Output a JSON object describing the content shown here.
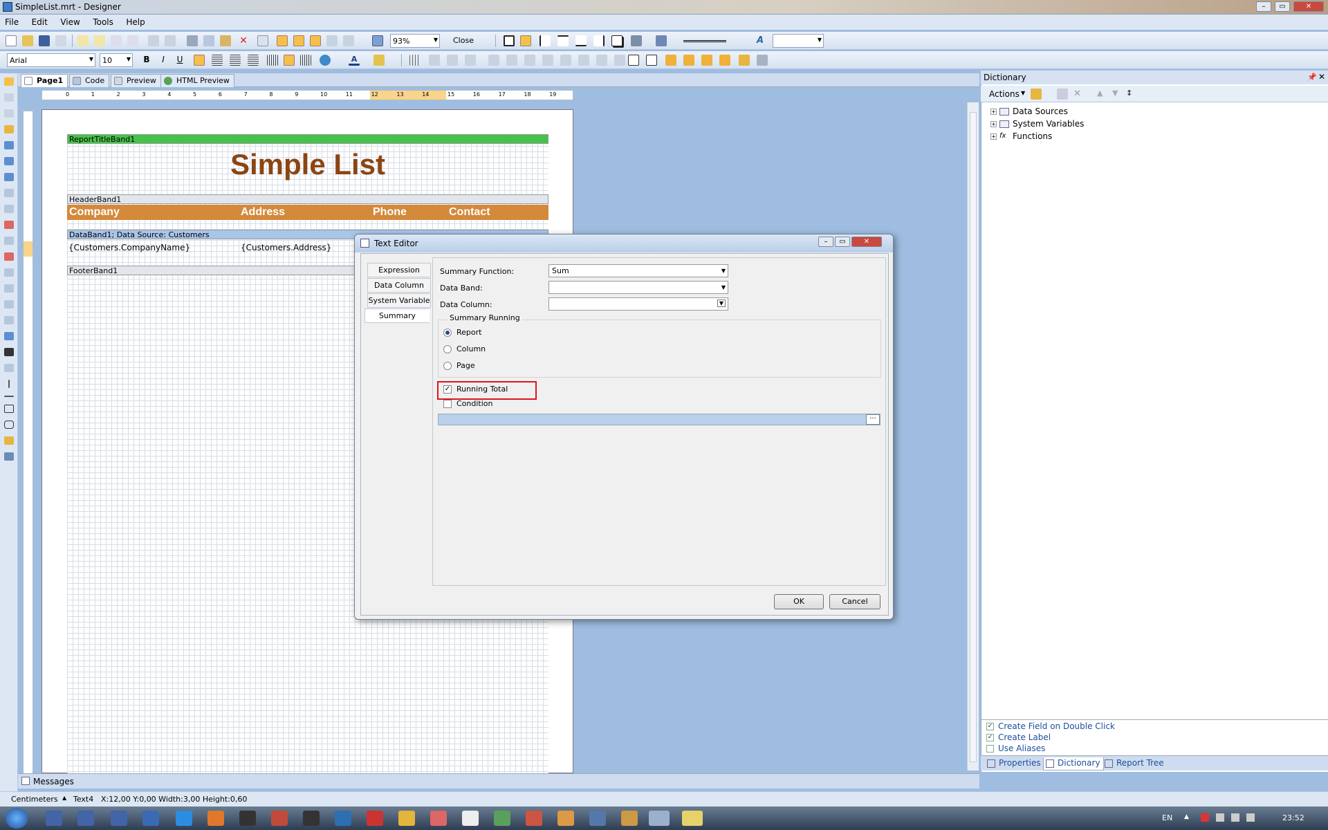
{
  "window": {
    "title": "SimpleList.mrt - Designer"
  },
  "menu": [
    "File",
    "Edit",
    "View",
    "Tools",
    "Help"
  ],
  "toolbar": {
    "zoom": "93%",
    "close_label": "Close"
  },
  "format": {
    "font": "Arial",
    "size": "10",
    "bold": "B",
    "italic": "I",
    "underline": "U"
  },
  "doc_tabs": [
    "Page1",
    "Code",
    "Preview",
    "HTML Preview"
  ],
  "ruler_marks": [
    "0",
    "1",
    "2",
    "3",
    "4",
    "5",
    "6",
    "7",
    "8",
    "9",
    "10",
    "11",
    "12",
    "13",
    "14",
    "15",
    "16",
    "17",
    "18",
    "19"
  ],
  "report": {
    "title_band": "ReportTitleBand1",
    "title_text": "Simple List",
    "header_band": "HeaderBand1",
    "headers": [
      "Company",
      "Address",
      "Phone",
      "Contact"
    ],
    "data_band": "DataBand1; Data Source: Customers",
    "data_fields": [
      "{Customers.CompanyName}",
      "{Customers.Address}"
    ],
    "footer_band": "FooterBand1"
  },
  "messages": {
    "label": "Messages"
  },
  "status": {
    "units": "Centimeters",
    "component": "Text4",
    "coords": "X:12,00  Y:0,00  Width:3,00  Height:0,60"
  },
  "dictionary": {
    "title": "Dictionary",
    "actions": "Actions",
    "tree": [
      "Data Sources",
      "System Variables",
      "Functions"
    ],
    "options": [
      {
        "label": "Create Field on Double Click",
        "checked": true
      },
      {
        "label": "Create Label",
        "checked": true
      },
      {
        "label": "Use Aliases",
        "checked": false
      }
    ],
    "tabs": [
      "Properties",
      "Dictionary",
      "Report Tree"
    ]
  },
  "dialog": {
    "title": "Text Editor",
    "tabs": [
      "Expression",
      "Data Column",
      "System Variable",
      "Summary"
    ],
    "summary_function_label": "Summary Function:",
    "summary_function_value": "Sum",
    "data_band_label": "Data Band:",
    "data_band_value": "",
    "data_column_label": "Data Column:",
    "data_column_value": "",
    "running_group": "Summary Running",
    "running_options": [
      "Report",
      "Column",
      "Page"
    ],
    "running_selected": "Report",
    "running_total_label": "Running Total",
    "running_total_checked": true,
    "condition_label": "Condition",
    "condition_checked": false,
    "ok": "OK",
    "cancel": "Cancel"
  },
  "taskbar": {
    "lang": "EN",
    "time": "23:52"
  },
  "colors": {
    "title_band": "#46c24a",
    "header_fill": "#d4893b",
    "title_text": "#8b4513",
    "highlight": "#e1131b"
  }
}
